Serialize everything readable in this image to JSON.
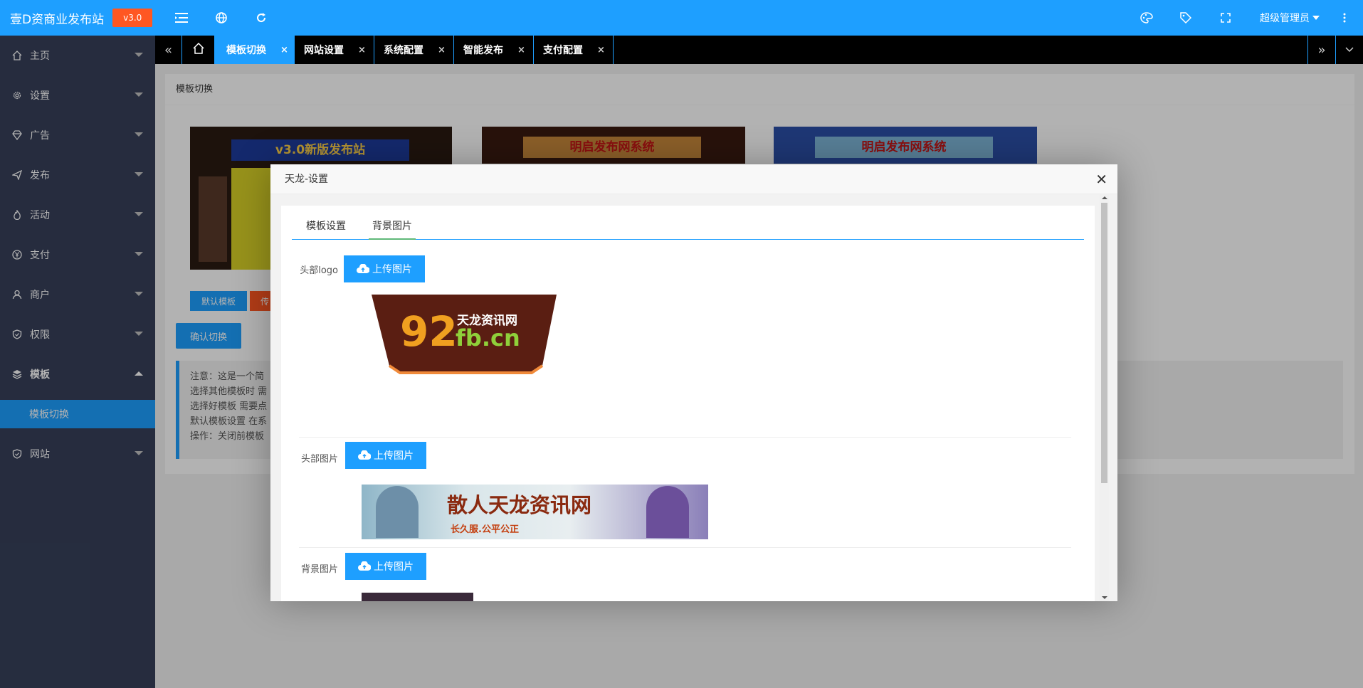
{
  "brand": {
    "title": "壹D资商业发布站",
    "version": "v3.0"
  },
  "header": {
    "user": "超级管理员"
  },
  "sidebar": {
    "items": [
      {
        "label": "主页",
        "icon": "home-icon"
      },
      {
        "label": "设置",
        "icon": "gear-icon"
      },
      {
        "label": "广告",
        "icon": "diamond-icon"
      },
      {
        "label": "发布",
        "icon": "send-icon"
      },
      {
        "label": "活动",
        "icon": "fire-icon"
      },
      {
        "label": "支付",
        "icon": "yen-icon"
      },
      {
        "label": "商户",
        "icon": "user-icon"
      },
      {
        "label": "权限",
        "icon": "shield-icon"
      },
      {
        "label": "模板",
        "icon": "layers-icon"
      },
      {
        "label": "网站",
        "icon": "shield-icon"
      }
    ],
    "active_sub": "模板切换"
  },
  "tabs": [
    {
      "label": "模板切换"
    },
    {
      "label": "网站设置"
    },
    {
      "label": "系统配置"
    },
    {
      "label": "智能发布"
    },
    {
      "label": "支付配置"
    }
  ],
  "main": {
    "panel_title": "模板切换",
    "default_btn": "默认模板",
    "orange_btn": "传",
    "confirm_btn": "确认切换",
    "notice": [
      "注意：这是一个简",
      "选择其他模板时 需",
      "选择好模板 需要点",
      "默认模板设置 在系",
      "操作：关闭前模板"
    ],
    "thumb1_text": "v3.0新版发布站",
    "thumb2_text": "明启发布网系统",
    "thumb3_text": "明启发布网系统"
  },
  "modal": {
    "title": "天龙-设置",
    "tabs": [
      "模板设置",
      "背景图片"
    ],
    "rows": [
      {
        "label": "头部logo",
        "button": "上传图片"
      },
      {
        "label": "头部图片",
        "button": "上传图片"
      },
      {
        "label": "背景图片",
        "button": "上传图片"
      }
    ],
    "logo_line1": "天龙资讯网",
    "logo_num": "92",
    "logo_dom": "fb.cn",
    "banner_title": "散人天龙资讯网",
    "banner_sub": "长久服.公平公正"
  },
  "colors": {
    "accent": "#1e9fff",
    "sidebar": "#37405a",
    "orange": "#ff5722"
  }
}
